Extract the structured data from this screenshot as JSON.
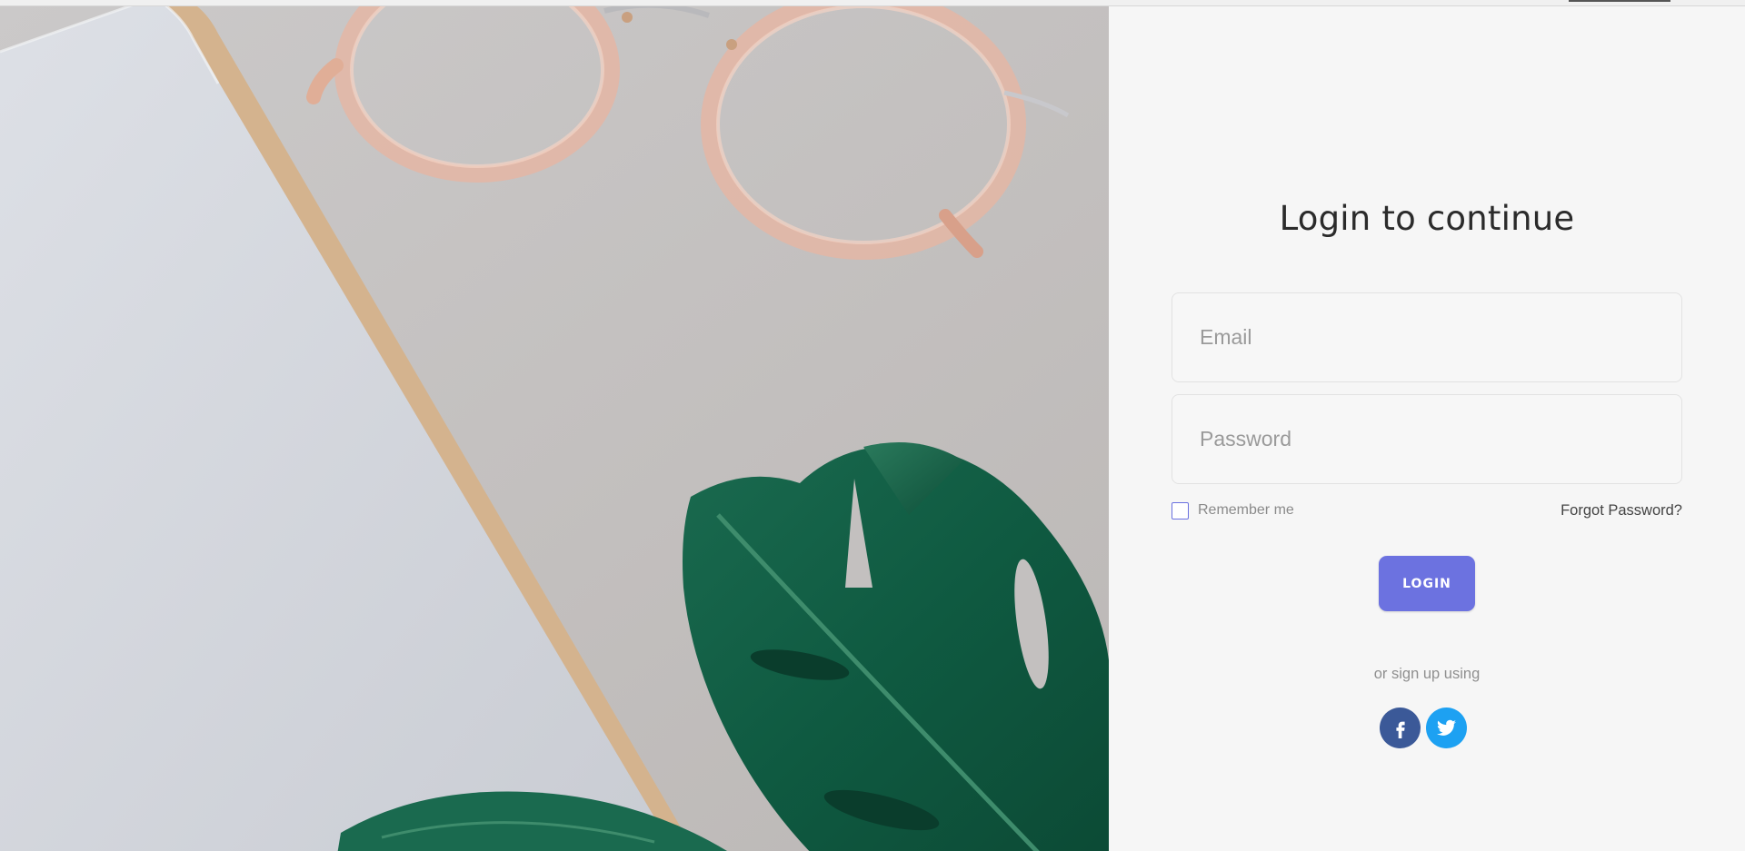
{
  "hero": {
    "image": "workspace-photo",
    "objects": [
      "notebook",
      "eyeglasses",
      "monstera-leaves"
    ]
  },
  "login": {
    "title": "Login to continue",
    "email": {
      "placeholder": "Email",
      "value": ""
    },
    "password": {
      "placeholder": "Password",
      "value": ""
    },
    "remember_label": "Remember me",
    "remember_checked": false,
    "forgot_label": "Forgot Password?",
    "login_label": "LOGIN",
    "signup_text": "or sign up using",
    "social": [
      {
        "name": "facebook",
        "icon": "facebook-icon",
        "color": "#3b5998"
      },
      {
        "name": "twitter",
        "icon": "twitter-icon",
        "color": "#1da1f2"
      }
    ],
    "accent_color": "#6c72e0"
  }
}
